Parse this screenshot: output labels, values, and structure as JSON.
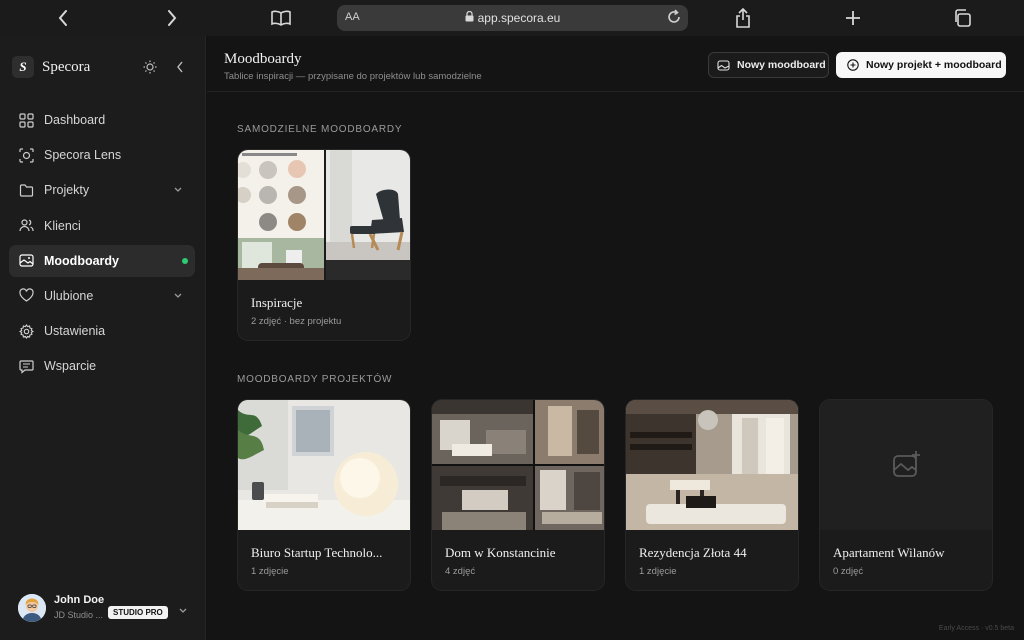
{
  "browser": {
    "aa_label": "AA",
    "url": "app.specora.eu"
  },
  "sidebar": {
    "brand": {
      "logo_letter": "S",
      "name": "Specora"
    },
    "items": [
      {
        "label": "Dashboard",
        "icon": "grid-icon",
        "active": false,
        "chevron": false
      },
      {
        "label": "Specora Lens",
        "icon": "lens-icon",
        "active": false,
        "chevron": false
      },
      {
        "label": "Projekty",
        "icon": "folder-icon",
        "active": false,
        "chevron": true
      },
      {
        "label": "Klienci",
        "icon": "users-icon",
        "active": false,
        "chevron": false
      },
      {
        "label": "Moodboardy",
        "icon": "moodboard-icon",
        "active": true,
        "chevron": false
      },
      {
        "label": "Ulubione",
        "icon": "heart-icon",
        "active": false,
        "chevron": true
      },
      {
        "label": "Ustawienia",
        "icon": "gear-icon",
        "active": false,
        "chevron": false
      },
      {
        "label": "Wsparcie",
        "icon": "chat-icon",
        "active": false,
        "chevron": false
      }
    ],
    "user": {
      "name": "John Doe",
      "studio": "JD Studio ...",
      "plan": "STUDIO PRO"
    }
  },
  "header": {
    "title": "Moodboardy",
    "subtitle": "Tablice inspiracji — przypisane do projektów lub samodzielne",
    "new_moodboard": "Nowy moodboard",
    "new_project_moodboard": "Nowy projekt + moodboard"
  },
  "sections": {
    "standalone_label": "SAMODZIELNE MOODBOARDY",
    "projects_label": "MOODBOARDY PROJEKTÓW"
  },
  "standalone_cards": [
    {
      "title": "Inspiracje",
      "meta": "2 zdjęć · bez projektu"
    }
  ],
  "project_cards": [
    {
      "title": "Biuro Startup Technolo...",
      "meta": "1 zdjęcie"
    },
    {
      "title": "Dom w Konstancinie",
      "meta": "4 zdjęć"
    },
    {
      "title": "Rezydencja Złota 44",
      "meta": "1 zdjęcie"
    },
    {
      "title": "Apartament Wilanów",
      "meta": "0 zdjęć"
    }
  ],
  "footer": "Early Access · v0.5 beta"
}
